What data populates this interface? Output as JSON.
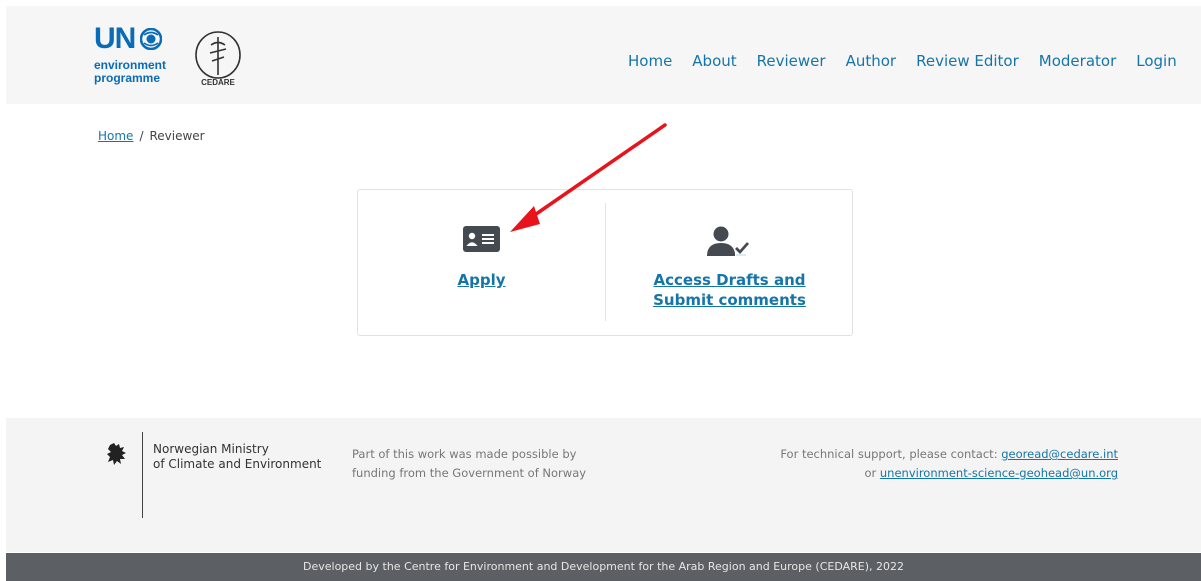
{
  "header": {
    "logo_un": "UN",
    "logo_line1": "environment",
    "logo_line2": "programme",
    "logo_cedare": "CEDARE",
    "nav": [
      {
        "label": "Home"
      },
      {
        "label": "About"
      },
      {
        "label": "Reviewer"
      },
      {
        "label": "Author"
      },
      {
        "label": "Review Editor"
      },
      {
        "label": "Moderator"
      },
      {
        "label": "Login"
      }
    ]
  },
  "breadcrumb": {
    "home": "Home",
    "separator": "/",
    "current": "Reviewer"
  },
  "card": {
    "apply": {
      "label": "Apply",
      "icon": "id-card-icon"
    },
    "drafts": {
      "label": "Access Drafts and Submit comments",
      "icon": "user-check-icon"
    }
  },
  "annotation": {
    "color": "#e8141b",
    "icon": "red-arrow"
  },
  "footer": {
    "ministry_line1": "Norwegian Ministry",
    "ministry_line2": "of Climate and Environment",
    "funding_line1": "Part of this work was made possible by",
    "funding_line2": "funding from the Government of Norway",
    "support_prefix": "For technical support, please contact: ",
    "support_email1": "georead@cedare.int",
    "support_or": "or ",
    "support_email2": "unenvironment-science-geohead@un.org",
    "bottom": "Developed by the Centre for Environment and Development for the Arab Region and Europe (CEDARE), 2022"
  },
  "colors": {
    "link": "#1675a8",
    "unep_blue": "#0a6bb6",
    "header_bg": "#f6f6f6",
    "footer_bg": "#f4f4f4",
    "bottom_bar": "#5c6064"
  }
}
